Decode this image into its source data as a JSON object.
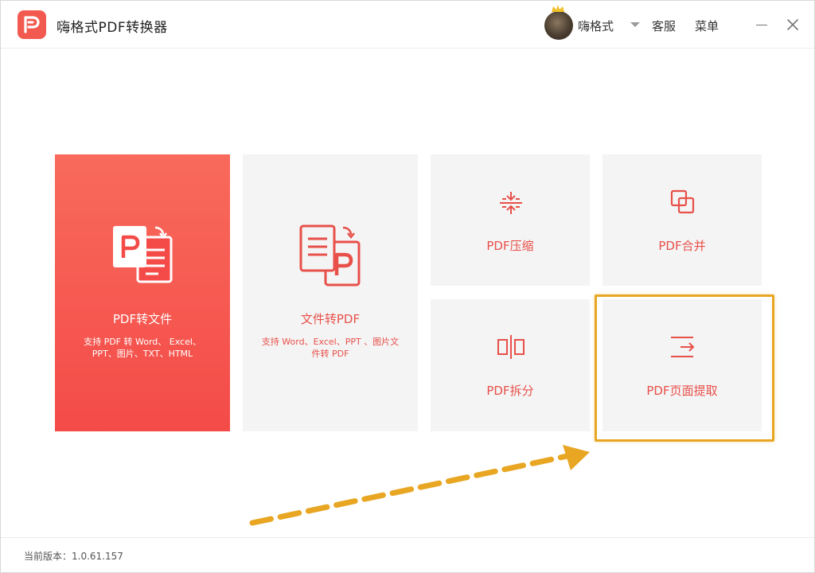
{
  "app": {
    "title": "嗨格式PDF转换器",
    "accent_color": "#f25a50"
  },
  "header": {
    "username": "嗨格式",
    "service_label": "客服",
    "menu_label": "菜单",
    "avatar_icon": "user-avatar-with-crown",
    "dropdown_icon": "caret-down-icon",
    "minimize_icon": "minimize-icon",
    "close_icon": "close-icon"
  },
  "cards": {
    "pdf_to_file": {
      "label": "PDF转文件",
      "desc_line1": "支持 PDF 转 Word、 Excel、",
      "desc_line2": "PPT、图片、TXT、HTML",
      "icon": "pdf-to-document-icon"
    },
    "file_to_pdf": {
      "label": "文件转PDF",
      "desc_line1": "支持 Word、Excel、PPT 、图片文",
      "desc_line2": "件转 PDF",
      "icon": "document-to-pdf-icon"
    },
    "compress": {
      "label": "PDF压缩",
      "icon": "compress-icon"
    },
    "merge": {
      "label": "PDF合并",
      "icon": "merge-icon"
    },
    "split": {
      "label": "PDF拆分",
      "icon": "split-icon"
    },
    "extract": {
      "label": "PDF页面提取",
      "icon": "extract-icon"
    }
  },
  "annotation": {
    "highlight_color": "#e8a623",
    "arrow_icon": "dashed-arrow-annotation"
  },
  "footer": {
    "version_label": "当前版本：1.0.61.157"
  }
}
